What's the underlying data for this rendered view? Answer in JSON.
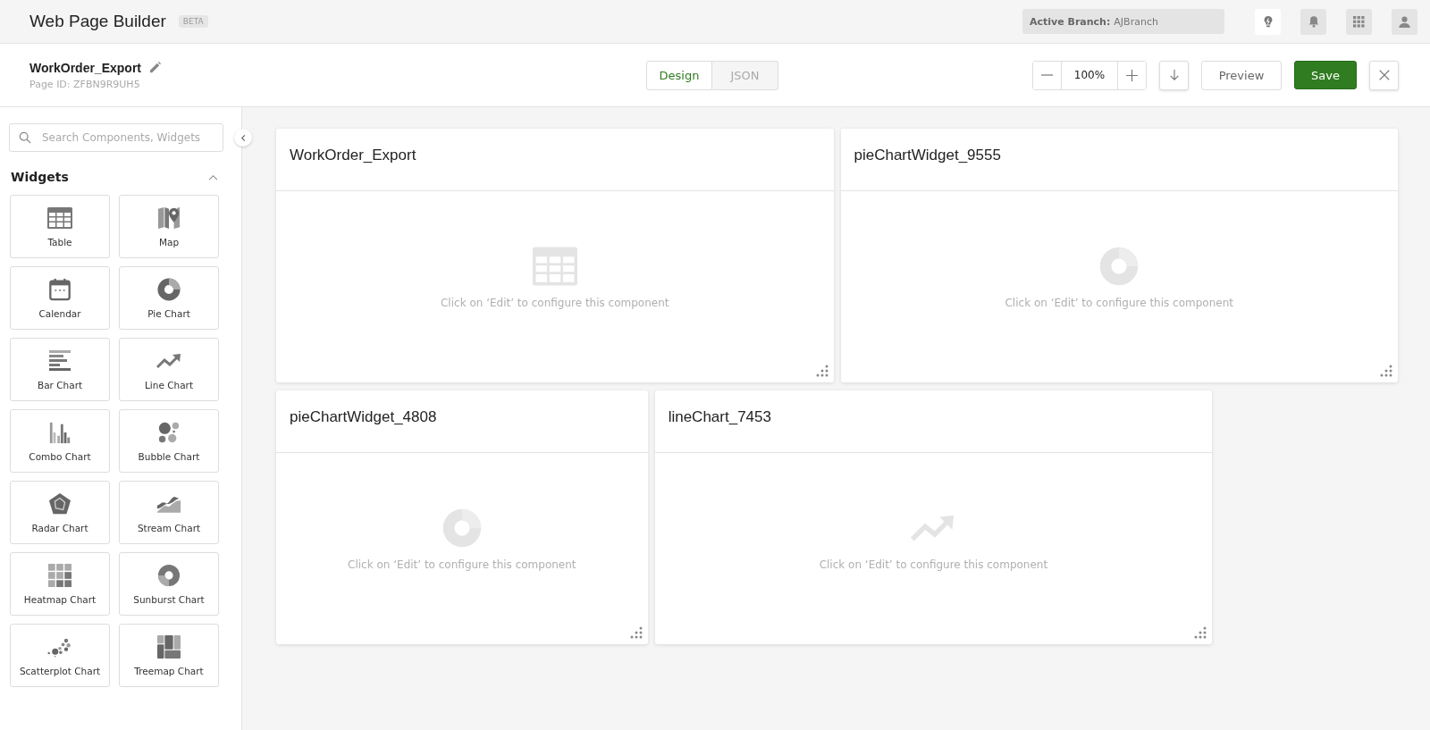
{
  "app_bar": {
    "title": "Web Page Builder",
    "badge": "BETA",
    "branch_label": "Active Branch:",
    "branch_value": "AJBranch"
  },
  "page_header": {
    "name": "WorkOrder_Export",
    "page_id": "Page ID: ZFBN9R9UH5",
    "tabs": [
      {
        "label": "Design",
        "selected": true
      },
      {
        "label": "JSON",
        "selected": false
      }
    ],
    "zoom": "100%",
    "preview": "Preview",
    "save": "Save"
  },
  "sidebar": {
    "search_placeholder": "Search Components, Widgets",
    "section_title": "Widgets",
    "expanded": true,
    "widgets": [
      {
        "label": "Table",
        "kind": "table"
      },
      {
        "label": "Map",
        "kind": "map"
      },
      {
        "label": "Calendar",
        "kind": "calendar"
      },
      {
        "label": "Pie Chart",
        "kind": "pie"
      },
      {
        "label": "Bar Chart",
        "kind": "bar"
      },
      {
        "label": "Line Chart",
        "kind": "line"
      },
      {
        "label": "Combo Chart",
        "kind": "combo"
      },
      {
        "label": "Bubble Chart",
        "kind": "bubble"
      },
      {
        "label": "Radar Chart",
        "kind": "radar"
      },
      {
        "label": "Stream Chart",
        "kind": "stream"
      },
      {
        "label": "Heatmap Chart",
        "kind": "heatmap"
      },
      {
        "label": "Sunburst Chart",
        "kind": "sunburst"
      },
      {
        "label": "Scatterplot Chart",
        "kind": "scatter"
      },
      {
        "label": "Treemap Chart",
        "kind": "treemap"
      }
    ]
  },
  "canvas_rows": [
    [
      {
        "title": "WorkOrder_Export",
        "kind": "table",
        "hint": "Click on ‘Edit’ to configure this component"
      },
      {
        "title": "pieChartWidget_9555",
        "kind": "pie",
        "hint": "Click on ‘Edit’ to configure this component"
      }
    ],
    [
      {
        "title": "pieChartWidget_4808",
        "kind": "pie",
        "hint": "Click on ‘Edit’ to configure this component"
      },
      {
        "title": "lineChart_7453",
        "kind": "line",
        "hint": "Click on ‘Edit’ to configure this component"
      }
    ]
  ]
}
